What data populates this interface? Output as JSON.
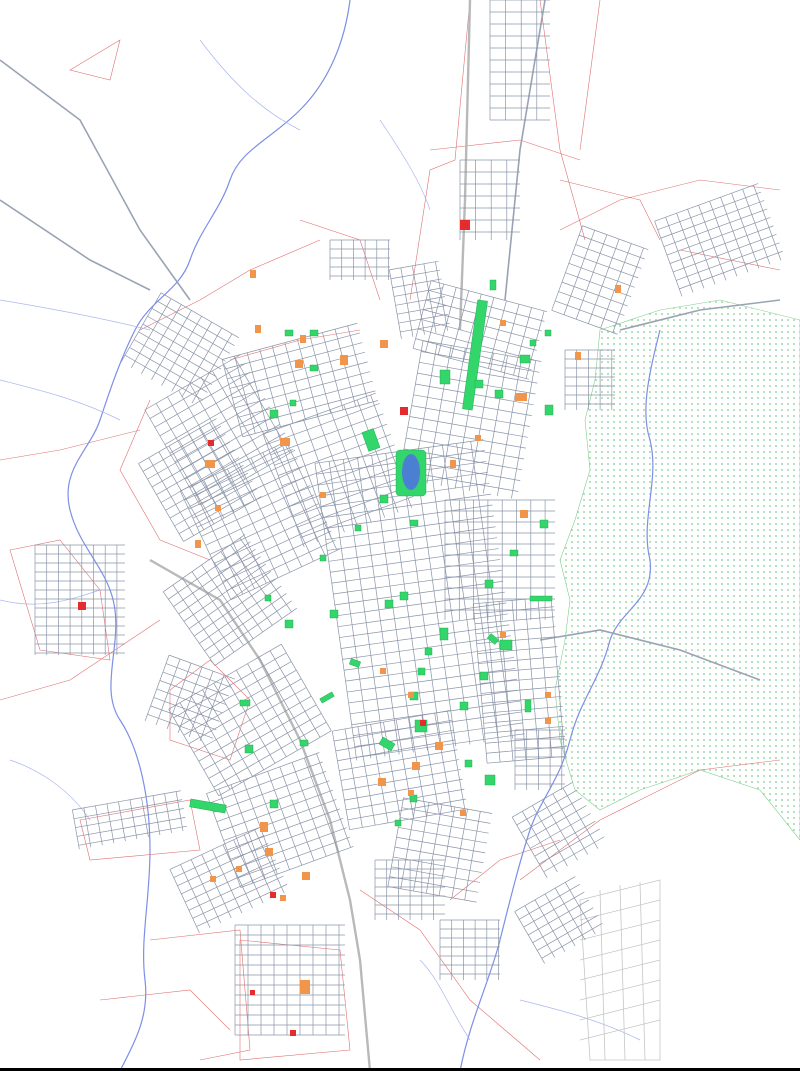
{
  "map": {
    "colors": {
      "background": "#ffffff",
      "street": "#8a95a8",
      "parcel_line": "#e07070",
      "river": "#7d8fe6",
      "park": "#33d66a",
      "plot_orange": "#f0954a",
      "plot_red": "#e52b2b",
      "wetland_dots": "#7fcf8d",
      "outskirts_grid": "#c6c6c6"
    },
    "features": [
      "street-grid",
      "parcel-boundaries",
      "rivers",
      "parks",
      "lots",
      "wetland-reserve",
      "central-lake"
    ]
  }
}
